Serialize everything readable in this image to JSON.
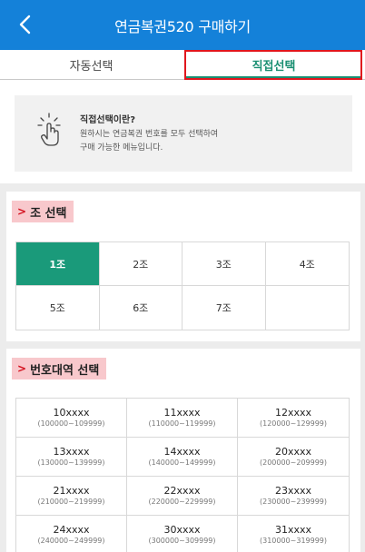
{
  "header": {
    "title": "연금복권520 구매하기",
    "back_icon": "chevron-left-icon"
  },
  "tabs": [
    {
      "label": "자동선택",
      "active": false
    },
    {
      "label": "직접선택",
      "active": true
    }
  ],
  "info": {
    "icon": "pointing-hand-icon",
    "title": "직접선택이란?",
    "desc_line1": "원하시는 연금복권 번호를 모두 선택하여",
    "desc_line2": "구매 가능한 메뉴입니다."
  },
  "jo_section": {
    "arrow": ">",
    "title": "조 선택",
    "items": [
      "1조",
      "2조",
      "3조",
      "4조",
      "5조",
      "6조",
      "7조"
    ],
    "selected": "1조"
  },
  "band_section": {
    "arrow": ">",
    "title": "번호대역 선택",
    "items": [
      {
        "label": "10xxxx",
        "range": "(100000~109999)"
      },
      {
        "label": "11xxxx",
        "range": "(110000~119999)"
      },
      {
        "label": "12xxxx",
        "range": "(120000~129999)"
      },
      {
        "label": "13xxxx",
        "range": "(130000~139999)"
      },
      {
        "label": "14xxxx",
        "range": "(140000~149999)"
      },
      {
        "label": "20xxxx",
        "range": "(200000~209999)"
      },
      {
        "label": "21xxxx",
        "range": "(210000~219999)"
      },
      {
        "label": "22xxxx",
        "range": "(220000~229999)"
      },
      {
        "label": "23xxxx",
        "range": "(230000~239999)"
      },
      {
        "label": "24xxxx",
        "range": "(240000~249999)"
      },
      {
        "label": "30xxxx",
        "range": "(300000~309999)"
      },
      {
        "label": "31xxxx",
        "range": "(310000~319999)"
      }
    ]
  },
  "colors": {
    "header_bg": "#1481d9",
    "selected_bg": "#1a9a7a",
    "active_tab_text": "#1a8f72",
    "highlight_border": "#e0161d",
    "section_title_bg": "#f8c8cc"
  }
}
